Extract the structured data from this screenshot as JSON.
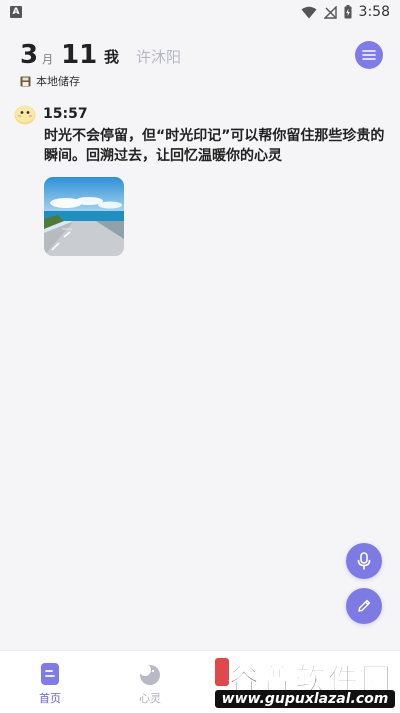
{
  "status_bar": {
    "app_icon": "A",
    "time": "3:58",
    "icons": [
      "wifi-icon",
      "no-signal-icon",
      "battery-icon"
    ]
  },
  "header": {
    "month": "3",
    "month_unit": "月",
    "day": "11",
    "tab_me": "我",
    "tab_other": "许沐阳",
    "storage_label": "本地储存",
    "menu_icon": "menu-icon"
  },
  "entry": {
    "time": "15:57",
    "mood_icon": "smiley-mood-icon",
    "text": "时光不会停留，但“时光印记”可以帮你留住那些珍贵的瞬间。回溯过去，让回忆温暖你的心灵",
    "photo": "road-by-sea-photo"
  },
  "fabs": {
    "voice_icon": "microphone-icon",
    "edit_icon": "pencil-icon"
  },
  "bottom_nav": {
    "items": [
      {
        "label": "首页",
        "icon": "home-doc-icon",
        "active": true
      },
      {
        "label": "心灵",
        "icon": "moon-icon",
        "active": false
      }
    ]
  },
  "watermark": {
    "title": "谷普软件园",
    "url": "www.gupuxlazal.com"
  },
  "colors": {
    "accent": "#7f7be9",
    "background": "#f5f5f7",
    "inactive_text": "#b7b7c4"
  }
}
